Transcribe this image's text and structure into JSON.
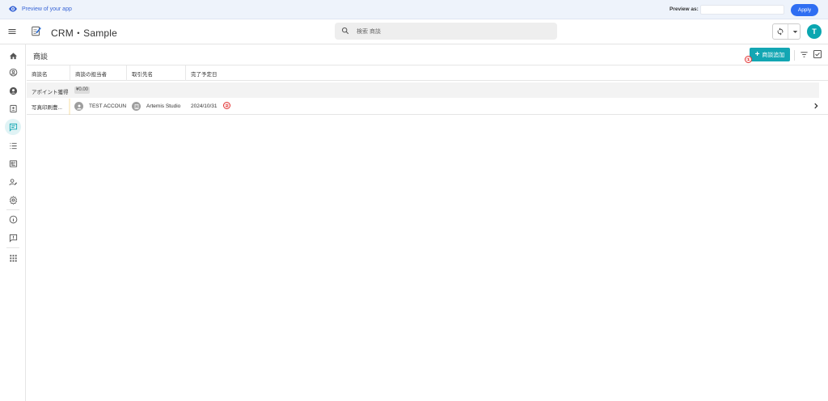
{
  "preview": {
    "label": "Preview of your app",
    "preview_as_label": "Preview as:",
    "preview_as_value": "",
    "apply_label": "Apply"
  },
  "header": {
    "app_title": "CRM・Sample",
    "search_placeholder": "検索 商談",
    "user_initial": "T"
  },
  "sidebar": {
    "items": [
      {
        "icon": "home-icon",
        "active": false
      },
      {
        "icon": "account-circle-outline-icon",
        "active": false
      },
      {
        "icon": "account-circle-icon",
        "active": false
      },
      {
        "icon": "contact-card-icon",
        "active": false
      },
      {
        "icon": "chat-icon",
        "active": true
      },
      {
        "icon": "checklist-icon",
        "active": false
      },
      {
        "icon": "newspaper-icon",
        "active": false
      },
      {
        "icon": "person-edit-icon",
        "active": false
      },
      {
        "icon": "settings-icon",
        "active": false
      },
      {
        "icon": "info-icon",
        "active": false
      },
      {
        "icon": "feedback-icon",
        "active": false
      },
      {
        "icon": "apps-grid-icon",
        "active": false
      }
    ]
  },
  "main": {
    "page_title": "商談",
    "add_button_label": "商談追加",
    "markers": [
      "①",
      "②"
    ],
    "columns": [
      "商談名",
      "商談の担当者",
      "取引先名",
      "完了予定日"
    ],
    "group": {
      "label": "アポイント獲得",
      "badge": "¥0.00"
    },
    "rows": [
      {
        "name": "写真印刷豊...",
        "owner": "TEST ACCOUN",
        "account": "Artemis Studio",
        "close_date": "2024/10/31"
      }
    ]
  },
  "colors": {
    "accent": "#13a6b3",
    "apply": "#2f6ef2",
    "marker": "#e23030",
    "avatar": "#0aa6b0"
  }
}
